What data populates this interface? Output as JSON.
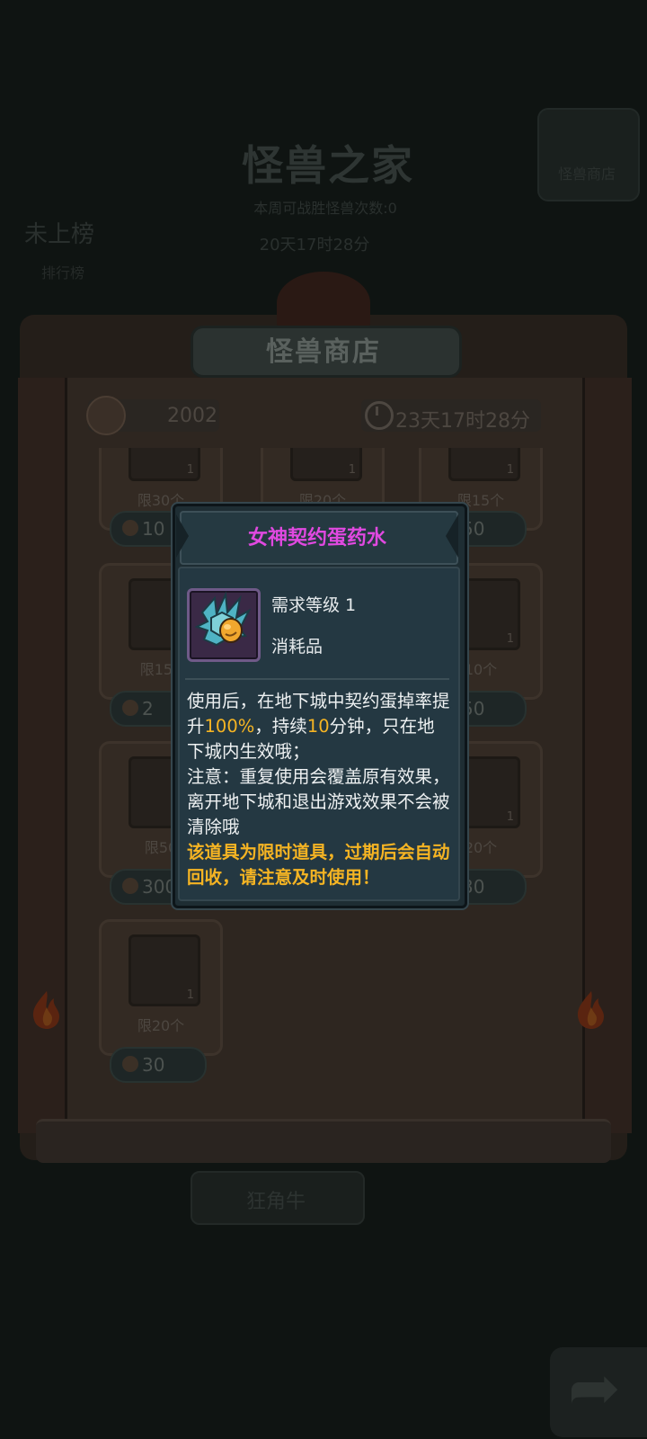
{
  "background": {
    "title": "怪兽之家",
    "subtitle": "本周可战胜怪兽次数:0",
    "event_timer": "20天17时28分",
    "rank_status": "未上榜",
    "rank_label": "排行榜",
    "right_button_label": "怪兽商店",
    "bottom_button_label": "狂角牛"
  },
  "shop": {
    "title": "怪兽商店",
    "currency": "2002",
    "refresh_timer": "23天17时28分",
    "items": [
      {
        "qty": "1",
        "limit": "限30个",
        "price": "10"
      },
      {
        "qty": "1",
        "limit": "限20个",
        "price": ""
      },
      {
        "qty": "1",
        "limit": "限15个",
        "price": "50"
      },
      {
        "qty": "",
        "limit": "限150",
        "price": "2"
      },
      {
        "qty": "",
        "limit": "",
        "price": ""
      },
      {
        "qty": "1",
        "limit": "10个",
        "price": "50"
      },
      {
        "qty": "",
        "limit": "限50",
        "price": "300"
      },
      {
        "qty": "",
        "limit": "",
        "price": ""
      },
      {
        "qty": "1",
        "limit": "20个",
        "price": "30"
      },
      {
        "qty": "1",
        "limit": "限20个",
        "price": "30"
      }
    ]
  },
  "popup": {
    "title": "女神契约蛋药水",
    "required_level": "需求等级 1",
    "item_type": "消耗品",
    "desc_part1": "使用后，在地下城中契约蛋掉率提升",
    "desc_rate": "100%",
    "desc_part2": "，持续",
    "desc_minutes": "10",
    "desc_part3": "分钟，只在地下城内生效哦；",
    "desc_note": "注意：重复使用会覆盖原有效果，离开地下城和退出游戏效果不会被清除哦",
    "desc_warning": "该道具为限时道具，过期后会自动回收，请注意及时使用！"
  },
  "colors": {
    "popup_title": "#e049e0",
    "highlight": "#f5b423",
    "popup_bg": "#243842"
  }
}
